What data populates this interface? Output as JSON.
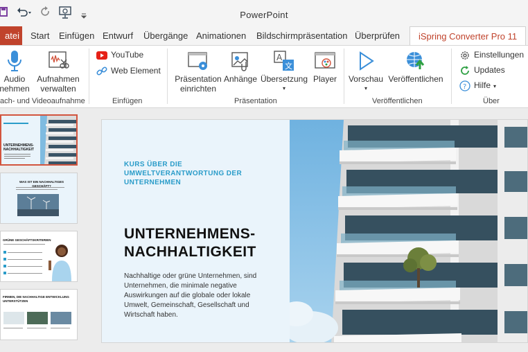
{
  "app_title": "PowerPoint",
  "tabs": {
    "file": "atei",
    "start": "Start",
    "insert": "Einfügen",
    "design": "Entwurf",
    "transitions": "Übergänge",
    "animations": "Animationen",
    "slideshow": "Bildschirmpräsentation",
    "review": "Überprüfen",
    "ispring": "iSpring Converter Pro 11"
  },
  "ribbon": {
    "audio_label_1": "Audio",
    "audio_label_2": "nehmen",
    "video_label_1": "Aufnahmen",
    "video_label_2": "verwalten",
    "group_record": "ach- und Videoaufnahme",
    "youtube": "YouTube",
    "web_element": "Web Element",
    "group_insert": "Einfügen",
    "presentation_setup_1": "Präsentation",
    "presentation_setup_2": "einrichten",
    "attachments": "Anhänge",
    "translation": "Übersetzung",
    "player": "Player",
    "group_presentation": "Präsentation",
    "preview": "Vorschau",
    "publish": "Veröffentlichen",
    "group_publish": "Veröffentlichen",
    "settings": "Einstellungen",
    "updates": "Updates",
    "help": "Hilfe",
    "group_about": "Über"
  },
  "thumbnails": {
    "t1_title": "UNTERNEHMENS-NACHHALTIGKEIT",
    "t2_title": "WAS IST EIN NACHHALTIGES GESCHÄFT?",
    "t3_title": "GRÜNE GESCHÄFTSKRITERIEN",
    "t4_title": "FIRMEN, DIE NACHHALTIGE ENTWICKLUNG UNTERSTÜTZEN"
  },
  "slide": {
    "subtitle": "KURS ÜBER DIE UMWELTVERANTWORTUNG DER UNTERNEHMEN",
    "title": "UNTERNEHMENS-NACHHALTIGKEIT",
    "body": "Nachhaltige oder grüne Unternehmen, sind Unternehmen, die minimale negative Auswirkungen auf die globale oder lokale Umwelt, Gemeinschaft, Gesellschaft und Wirtschaft haben."
  },
  "colors": {
    "accent": "#c0432c",
    "slide_accent": "#2a9cc9"
  }
}
